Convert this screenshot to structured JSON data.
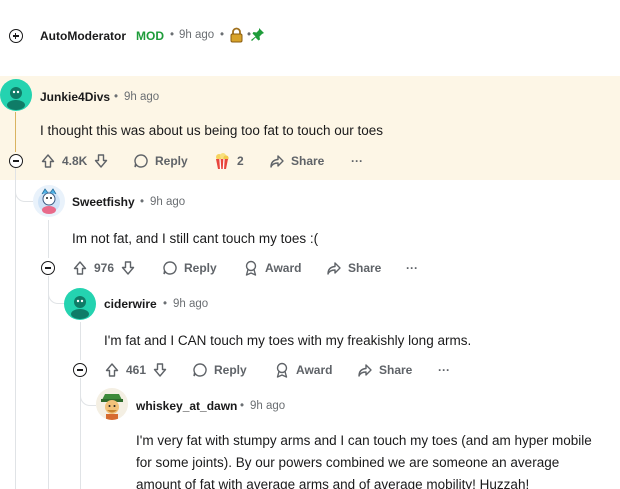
{
  "automod": {
    "username": "AutoModerator",
    "badge": "MOD",
    "time": "9h ago",
    "separator": "•",
    "lock_icon": "lock-icon",
    "pin_icon": "pin-icon"
  },
  "comments": [
    {
      "username": "Junkie4Divs",
      "time": "9h ago",
      "text": "I thought this was about us being too fat to touch our toes",
      "votes": "4.8K",
      "reply_label": "Reply",
      "award_count": "2",
      "share_label": "Share",
      "more": "···",
      "highlight_color": "#fdf6e6"
    },
    {
      "username": "Sweetfishy",
      "time": "9h ago",
      "text": "Im not fat, and I still cant touch my toes :(",
      "votes": "976",
      "reply_label": "Reply",
      "award_label": "Award",
      "share_label": "Share",
      "more": "···"
    },
    {
      "username": "ciderwire",
      "time": "9h ago",
      "text": "I'm fat and I CAN touch my toes with my freakishly long arms.",
      "votes": "461",
      "reply_label": "Reply",
      "award_label": "Award",
      "share_label": "Share",
      "more": "···"
    },
    {
      "username": "whiskey_at_dawn",
      "time": "9h ago",
      "text_lines": [
        "I'm very fat with stumpy arms and I can touch my toes (and am hyper mobile",
        "for some joints). By our powers combined we are someone an average",
        "amount of fat with average arms and of average mobility! Huzzah!"
      ]
    }
  ],
  "colors": {
    "accent_green": "#1e9c3a",
    "avatar_teal": "#24d3b0",
    "highlight_line": "#d9b360"
  }
}
